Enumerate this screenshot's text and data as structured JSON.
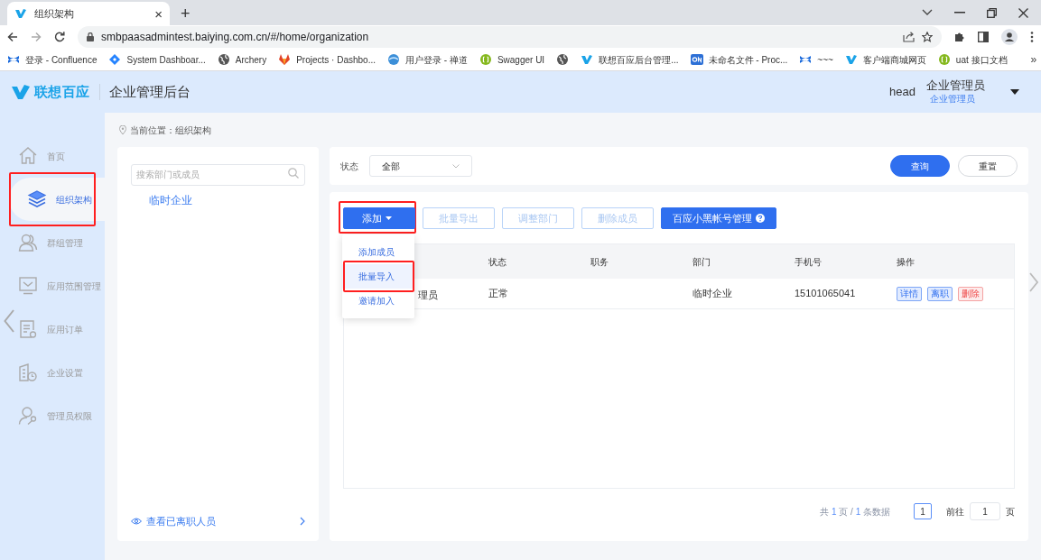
{
  "browser": {
    "tab": {
      "title": "组织架构",
      "close": "×",
      "new_tab": "+"
    },
    "url": "smbpaasadmintest.baiying.com.cn/#/home/organization",
    "bookmarks": [
      {
        "label": "登录 - Confluence",
        "kind": "confluence"
      },
      {
        "label": "System Dashboar...",
        "kind": "diamond"
      },
      {
        "label": "Archery",
        "kind": "globe"
      },
      {
        "label": "Projects · Dashbo...",
        "kind": "fox"
      },
      {
        "label": "用户登录 - 禅道",
        "kind": "orb"
      },
      {
        "label": "Swagger UI",
        "kind": "swagger"
      },
      {
        "kind": "globe"
      },
      {
        "label": "联想百应后台管理...",
        "kind": "v"
      },
      {
        "label": "未命名文件 - Proc...",
        "kind": "on"
      },
      {
        "label": "~~~",
        "kind": "confluence"
      },
      {
        "label": "客户端商城网页",
        "kind": "v"
      },
      {
        "label": "uat 接口文档",
        "kind": "swagger"
      }
    ],
    "more": "»"
  },
  "app": {
    "logo": "联想百应",
    "title": "企业管理后台",
    "user": {
      "avatar_alt": "head",
      "name": "企业管理员",
      "role": "企业管理员"
    }
  },
  "sidebar": {
    "items": [
      {
        "label": "首页",
        "selected": false,
        "highlighted": false
      },
      {
        "label": "组织架构",
        "selected": true,
        "highlighted": true
      },
      {
        "label": "群组管理",
        "selected": false,
        "highlighted": false
      },
      {
        "label": "应用范围管理",
        "selected": false,
        "highlighted": false
      },
      {
        "label": "应用订单",
        "selected": false,
        "highlighted": false
      },
      {
        "label": "企业设置",
        "selected": false,
        "highlighted": false
      },
      {
        "label": "管理员权限",
        "selected": false,
        "highlighted": false
      }
    ]
  },
  "breadcrumb": "当前位置：组织架构",
  "tree": {
    "search_placeholder": "搜索部门或成员",
    "nodes": [
      {
        "label": "临时企业"
      }
    ],
    "footer_link": "查看已离职人员"
  },
  "filter": {
    "label": "状态",
    "value": "全部",
    "buttons": [
      {
        "label": "查询",
        "kind": "primary"
      },
      {
        "label": "重置",
        "kind": "default"
      }
    ]
  },
  "toolbar": [
    {
      "label": "添加",
      "kind": "dropdown",
      "disabled": false,
      "highlighted": true
    },
    {
      "label": "批量导出",
      "kind": "plain",
      "disabled": true,
      "highlighted": false
    },
    {
      "label": "调整部门",
      "kind": "plain",
      "disabled": true,
      "highlighted": false
    },
    {
      "label": "删除成员",
      "kind": "plain",
      "disabled": true,
      "highlighted": false
    },
    {
      "label": "百应小黑帐号管理",
      "kind": "help",
      "disabled": false,
      "highlighted": false
    }
  ],
  "dropdown_menu": [
    {
      "label": "添加成员",
      "selected": false,
      "highlighted": false
    },
    {
      "label": "批量导入",
      "selected": true,
      "highlighted": true
    },
    {
      "label": "邀请加入",
      "selected": false,
      "highlighted": false
    }
  ],
  "table": {
    "columns": [
      "状态",
      "职务",
      "部门",
      "手机号",
      "操作"
    ],
    "rows": [
      {
        "name": "理员",
        "status": "正常",
        "department": "临时企业",
        "phone": "15101065041",
        "actions": [
          {
            "label": "详情",
            "kind": "info"
          },
          {
            "label": "离职",
            "kind": "info"
          },
          {
            "label": "删除",
            "kind": "danger"
          }
        ]
      }
    ]
  },
  "pagination": {
    "summary": [
      {
        "text": "共",
        "kind": "text"
      },
      {
        "text": "1",
        "kind": "number"
      },
      {
        "text": "页 /",
        "kind": "text"
      },
      {
        "text": "1",
        "kind": "number"
      },
      {
        "text": "条数据",
        "kind": "text"
      }
    ],
    "current_page": "1",
    "goto_label": "前往",
    "goto_value": "1",
    "page_unit": "页"
  }
}
